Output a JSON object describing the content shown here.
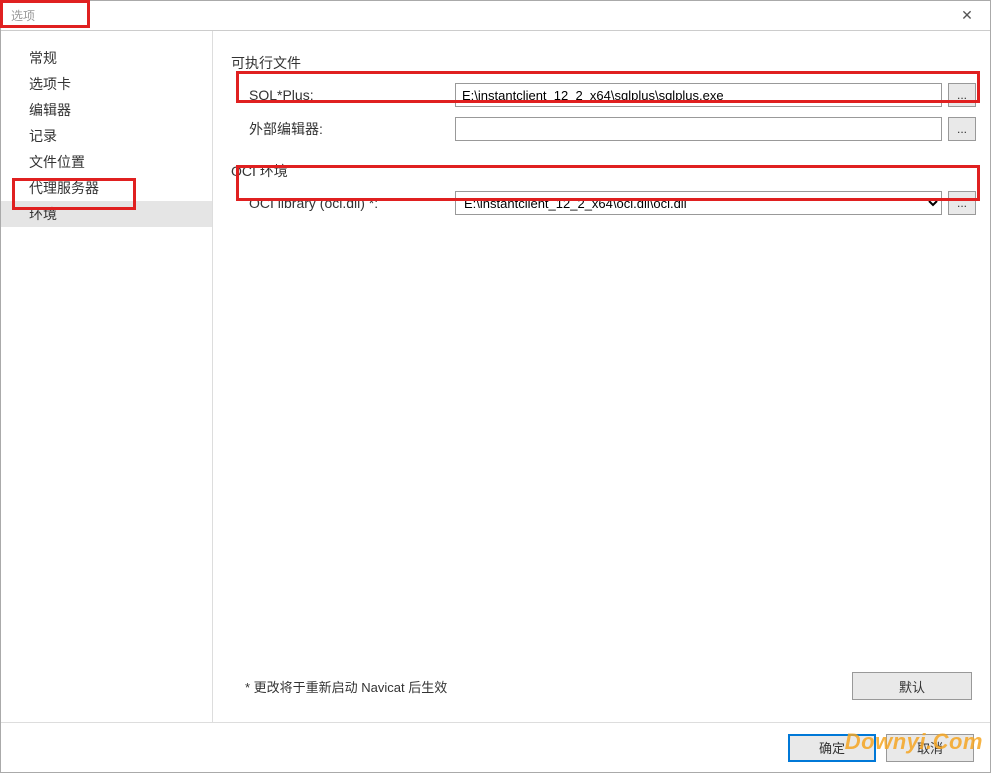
{
  "window": {
    "title": "选项",
    "close_glyph": "✕"
  },
  "sidebar": {
    "items": [
      {
        "label": "常规",
        "selected": false
      },
      {
        "label": "选项卡",
        "selected": false
      },
      {
        "label": "编辑器",
        "selected": false
      },
      {
        "label": "记录",
        "selected": false
      },
      {
        "label": "文件位置",
        "selected": false
      },
      {
        "label": "代理服务器",
        "selected": false
      },
      {
        "label": "环境",
        "selected": true
      }
    ]
  },
  "content": {
    "section_exec": {
      "title": "可执行文件",
      "rows": {
        "sqlplus": {
          "label": "SQL*Plus:",
          "value": "E:\\instantclient_12_2_x64\\sqlplus\\sqlplus.exe"
        },
        "external_editor": {
          "label": "外部编辑器:",
          "value": ""
        }
      }
    },
    "section_oci": {
      "title": "OCI 环境",
      "rows": {
        "oci_library": {
          "label": "OCI library (oci.dll) *:",
          "value": "E:\\instantclient_12_2_x64\\oci.dll\\oci.dll"
        }
      }
    },
    "restart_note": "* 更改将于重新启动 Navicat 后生效",
    "default_button": "默认",
    "browse_glyph": "..."
  },
  "footer": {
    "ok": "确定",
    "cancel": "取消"
  },
  "watermark": "Downyi.Com"
}
